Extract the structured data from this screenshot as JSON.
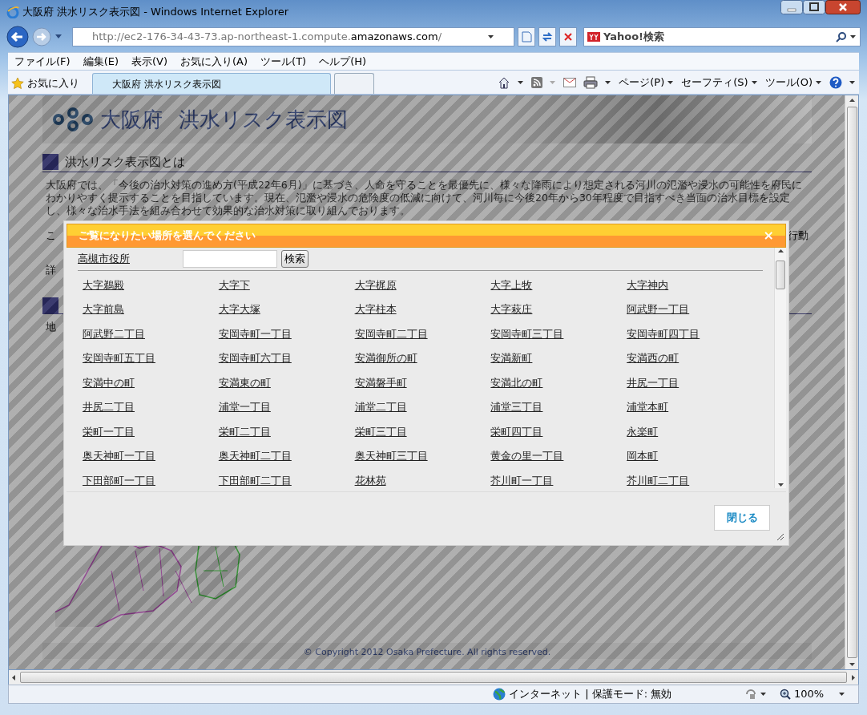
{
  "window": {
    "title": "大阪府 洪水リスク表示図 - Windows Internet Explorer"
  },
  "address_bar": {
    "url_prefix": "http://ec2-176-34-43-73.ap-northeast-1.compute.",
    "url_domain": "amazonaws.com",
    "url_suffix": "/"
  },
  "search_box": {
    "placeholder": "Yahoo!検索"
  },
  "menu": [
    "ファイル(F)",
    "編集(E)",
    "表示(V)",
    "お気に入り(A)",
    "ツール(T)",
    "ヘルプ(H)"
  ],
  "favorites": {
    "label": "お気に入り"
  },
  "tabs": [
    {
      "label": "大阪府 洪水リスク表示図",
      "selected": true
    },
    {
      "selected": false
    }
  ],
  "command_bar": [
    "ページ(P)",
    "セーフティ(S)",
    "ツール(O)"
  ],
  "page": {
    "logo_text": "大阪府",
    "site_title": "洪水リスク表示図",
    "section_heading": "洪水リスク表示図とは",
    "intro": "大阪府では、「今後の治水対策の進め方(平成22年6月)」に基づき、人命を守ることを最優先に、様々な降雨により想定される河川の氾濫や浸水の可能性を府民にわかりやすく提示することを目指しています。現在、氾濫や浸水の危険度の低減に向けて、河川毎に今後20年から30年程度で目指すべき当面の治水目標を設定し、様々な治水手法を組み合わせて効果的な治水対策に取り組んでおります。",
    "fragment_left": "こ",
    "fragment_right": "行動",
    "fragment_row2": "詳",
    "fragment_row3": "地",
    "copyright": "© Copyright 2012 Osaka Prefecture. All rights reserved."
  },
  "dialog": {
    "title": "ご覧になりたい場所を選んでください",
    "close_icon": "×",
    "current_place": "高槻市役所",
    "search_button": "検索",
    "places": [
      "大字鵜殿",
      "大字下",
      "大字梶原",
      "大字上牧",
      "大字神内",
      "大字前島",
      "大字大塚",
      "大字柱本",
      "大字萩庄",
      "阿武野一丁目",
      "阿武野二丁目",
      "安岡寺町一丁目",
      "安岡寺町二丁目",
      "安岡寺町三丁目",
      "安岡寺町四丁目",
      "安岡寺町五丁目",
      "安岡寺町六丁目",
      "安満御所の町",
      "安満新町",
      "安満西の町",
      "安満中の町",
      "安満東の町",
      "安満磐手町",
      "安満北の町",
      "井尻一丁目",
      "井尻二丁目",
      "浦堂一丁目",
      "浦堂二丁目",
      "浦堂三丁目",
      "浦堂本町",
      "栄町一丁目",
      "栄町二丁目",
      "栄町三丁目",
      "栄町四丁目",
      "永楽町",
      "奥天神町一丁目",
      "奥天神町二丁目",
      "奥天神町三丁目",
      "黄金の里一丁目",
      "岡本町",
      "下田部町一丁目",
      "下田部町二丁目",
      "花林苑",
      "芥川町一丁目",
      "芥川町二丁目"
    ],
    "close_button": "閉じる"
  },
  "status_bar": {
    "zone": "インターネット | 保護モード: 無効",
    "zoom": "100%"
  }
}
